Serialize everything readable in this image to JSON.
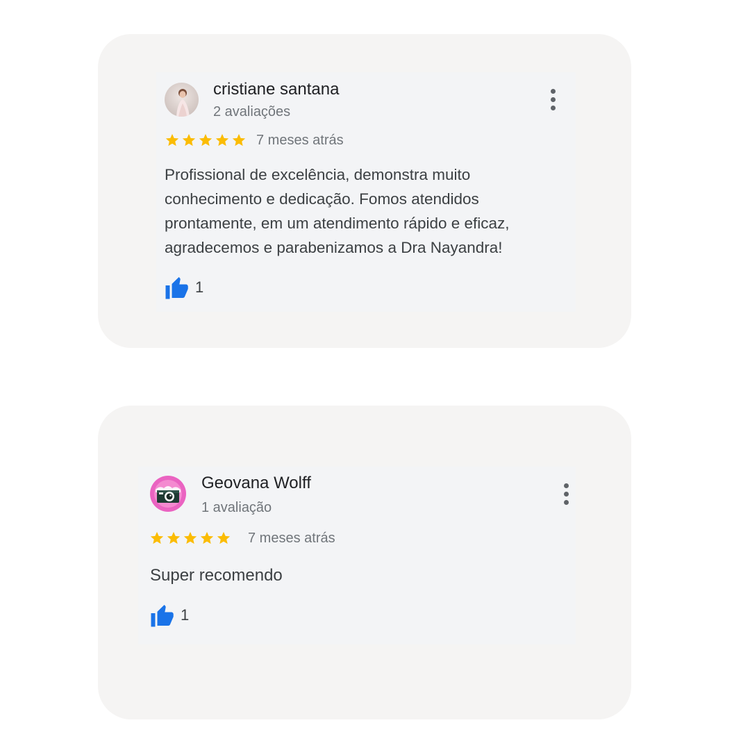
{
  "reviews": [
    {
      "author": "cristiane santana",
      "review_count": "2 avaliações",
      "rating": 5,
      "date": "7 meses atrás",
      "text": "Profissional de excelência, demonstra muito conhecimento e dedicação. Fomos atendidos prontamente, em um atendimento rápido e eficaz, agradecemos e parabenizamos a Dra Nayandra!",
      "likes": "1",
      "avatar_icon": "user-photo-icon"
    },
    {
      "author": "Geovana Wolff",
      "review_count": "1 avaliação",
      "rating": 5,
      "date": "7 meses atrás",
      "text": "Super recomendo",
      "likes": "1",
      "avatar_icon": "camera-icon"
    }
  ],
  "colors": {
    "star": "#fbbc04",
    "like": "#1a73e8",
    "card_bg": "#f5f4f3",
    "review_bg": "#f3f4f6"
  }
}
